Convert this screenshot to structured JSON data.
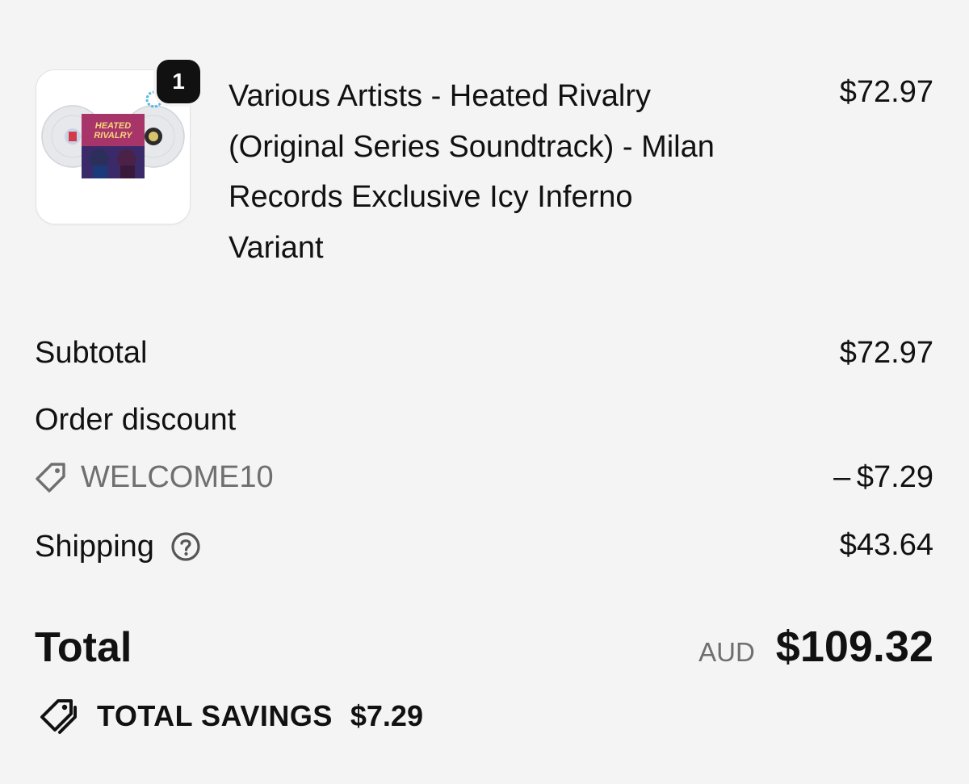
{
  "line_item": {
    "quantity": "1",
    "title_lines": [
      "Various Artists - Heated Rivalry",
      "(Original Series Soundtrack) - Milan",
      "Records Exclusive Icy Inferno",
      "Variant"
    ],
    "price": "$72.97",
    "cover_text_1": "HEATED",
    "cover_text_2": "RIVALRY"
  },
  "summary": {
    "subtotal_label": "Subtotal",
    "subtotal_value": "$72.97",
    "discount_label": "Order discount",
    "discount_code": "WELCOME10",
    "discount_value": "– $7.29",
    "shipping_label": "Shipping",
    "shipping_value": "$43.64",
    "total_label": "Total",
    "currency": "AUD",
    "total_value": "$109.32",
    "savings_label": "TOTAL SAVINGS",
    "savings_value": "$7.29"
  },
  "icons": {
    "discount": "tag-icon",
    "shipping_help": "question-circle-icon",
    "savings": "double-tag-icon"
  },
  "colors": {
    "background": "#f4f4f4",
    "text": "#111111",
    "muted": "#6f6f6f",
    "badge": "#111111"
  }
}
